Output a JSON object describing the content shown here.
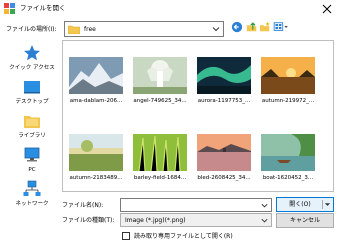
{
  "title": "ファイルを開く",
  "location": {
    "label": "ファイルの場所(I):",
    "value": "free",
    "folder_icon": "folder-icon"
  },
  "toolbar": {
    "icons": [
      "back-icon",
      "up-folder-icon",
      "new-folder-icon",
      "view-menu-icon"
    ]
  },
  "places": [
    {
      "label": "クイック アクセス",
      "icon": "star-icon"
    },
    {
      "label": "デスクトップ",
      "icon": "desktop-icon"
    },
    {
      "label": "ライブラリ",
      "icon": "library-icon"
    },
    {
      "label": "PC",
      "icon": "pc-icon"
    },
    {
      "label": "ネットワーク",
      "icon": "network-icon"
    }
  ],
  "files": [
    {
      "name": "ama-dablam-206...",
      "kind": "mountain"
    },
    {
      "name": "angel-749625_34...",
      "kind": "angel"
    },
    {
      "name": "aurora-1197753_...",
      "kind": "aurora"
    },
    {
      "name": "autumn-219972_...",
      "kind": "sunset-lake"
    },
    {
      "name": "autumn-2183489...",
      "kind": "field"
    },
    {
      "name": "barley-field-1684...",
      "kind": "barley"
    },
    {
      "name": "bled-2608425_34...",
      "kind": "lake"
    },
    {
      "name": "boat-1620452_3...",
      "kind": "boat"
    }
  ],
  "bottom": {
    "filename_label": "ファイル名(N):",
    "filename_value": "",
    "filetype_label": "ファイルの種類(T):",
    "filetype_value": "Image (*.jpg)(*.png)",
    "open_label": "開く(O)",
    "cancel_label": "キャンセル",
    "readonly_label": "読み取り専用ファイルとして開く(R)"
  },
  "colors": {
    "accent": "#0078d7",
    "folder": "#f3c64f"
  }
}
